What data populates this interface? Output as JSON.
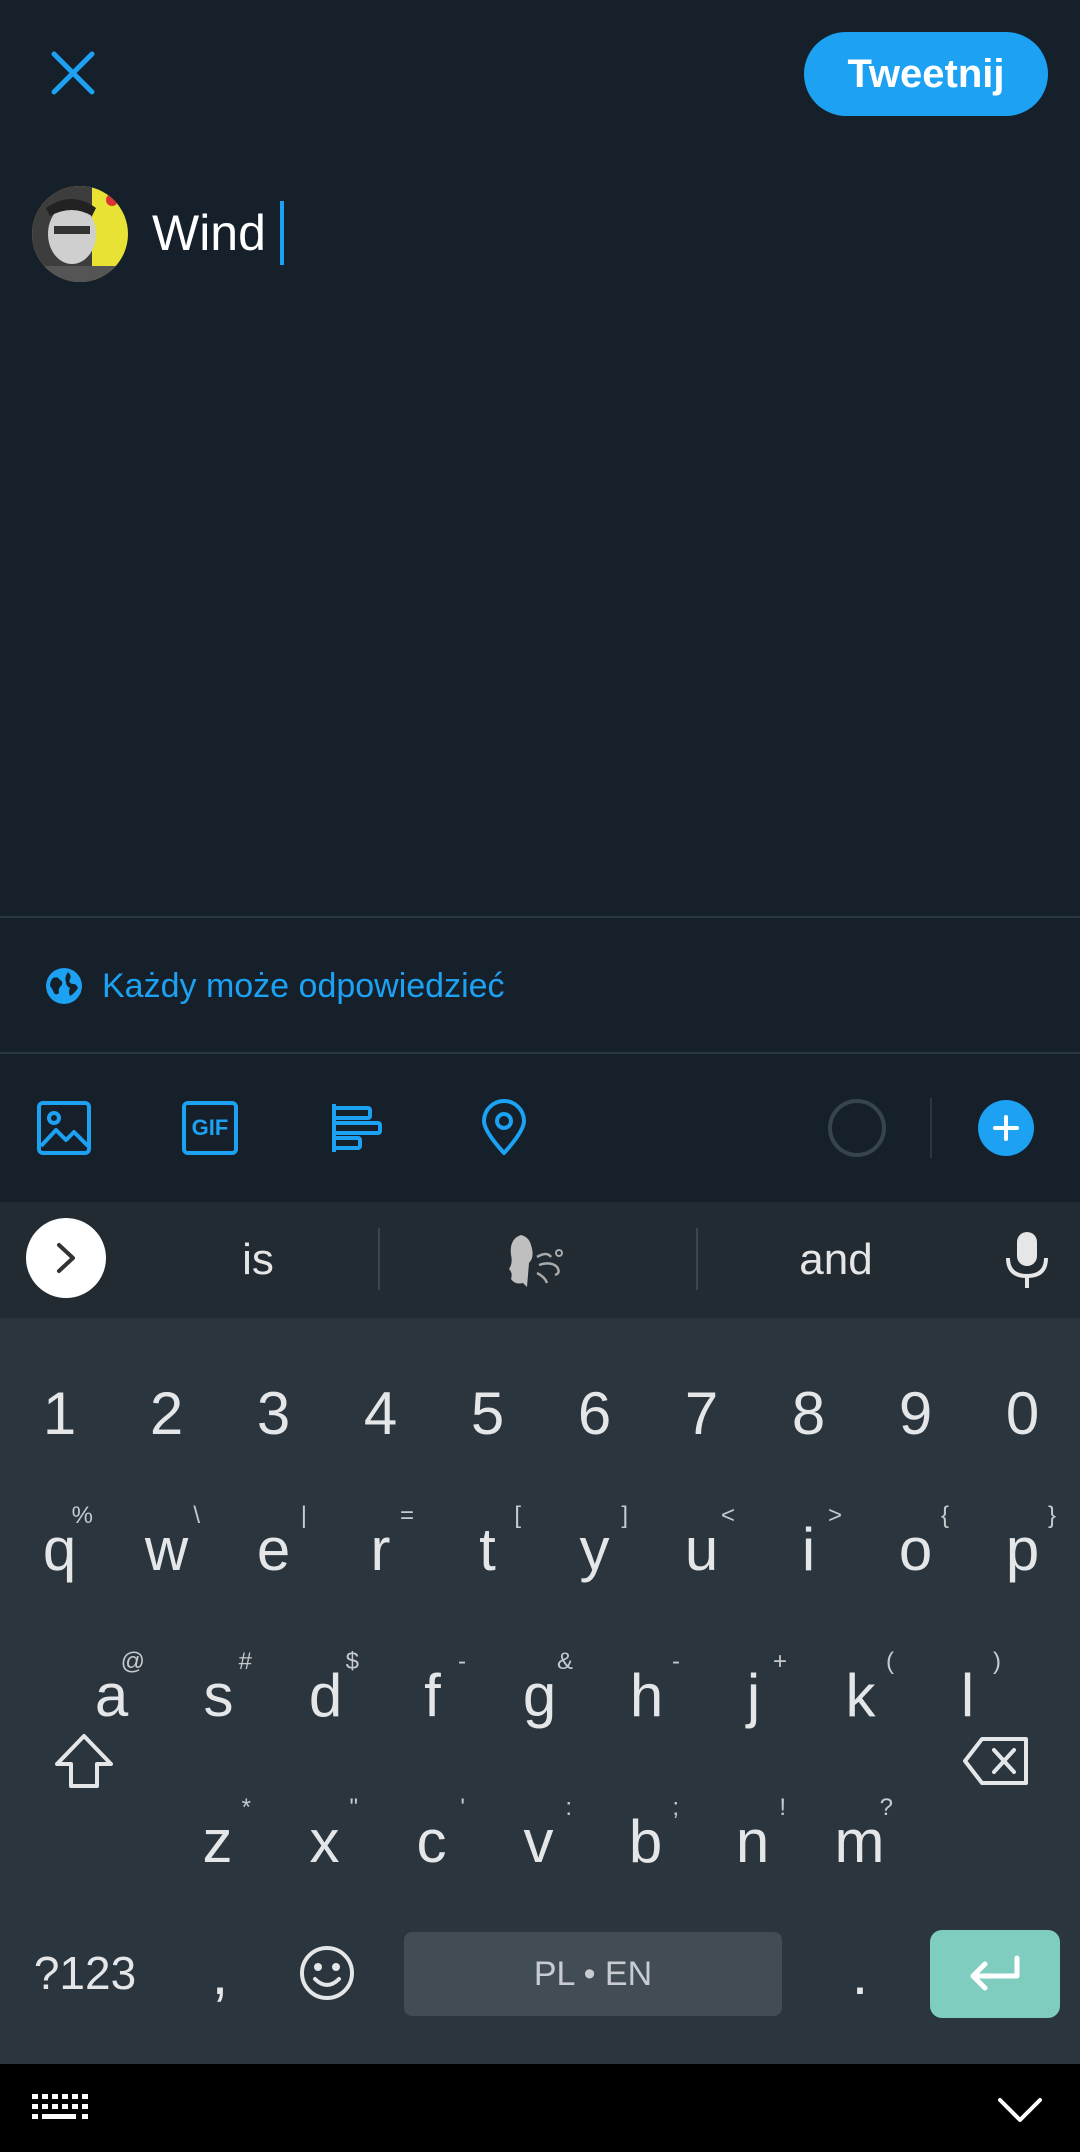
{
  "header": {
    "close_icon": "close-icon",
    "tweet_button_label": "Tweetnij"
  },
  "composer": {
    "text": "Wind",
    "avatar": "user-avatar"
  },
  "reply_settings": {
    "label": "Każdy może odpowiedzieć",
    "icon": "globe-icon"
  },
  "toolbar": {
    "icons": [
      "image-icon",
      "gif-icon",
      "poll-icon",
      "location-icon"
    ],
    "gif_text": "GIF",
    "add_icon": "plus-icon"
  },
  "suggestions": {
    "items": [
      "is",
      "and"
    ],
    "emoji_suggestion": "wind-face-emoji"
  },
  "keyboard": {
    "number_row": [
      "1",
      "2",
      "3",
      "4",
      "5",
      "6",
      "7",
      "8",
      "9",
      "0"
    ],
    "row1": [
      {
        "key": "q",
        "hint": "%"
      },
      {
        "key": "w",
        "hint": "\\"
      },
      {
        "key": "e",
        "hint": "|"
      },
      {
        "key": "r",
        "hint": "="
      },
      {
        "key": "t",
        "hint": "["
      },
      {
        "key": "y",
        "hint": "]"
      },
      {
        "key": "u",
        "hint": "<"
      },
      {
        "key": "i",
        "hint": ">"
      },
      {
        "key": "o",
        "hint": "{"
      },
      {
        "key": "p",
        "hint": "}"
      }
    ],
    "row2": [
      {
        "key": "a",
        "hint": "@"
      },
      {
        "key": "s",
        "hint": "#"
      },
      {
        "key": "d",
        "hint": "$"
      },
      {
        "key": "f",
        "hint": "-"
      },
      {
        "key": "g",
        "hint": "&"
      },
      {
        "key": "h",
        "hint": "-"
      },
      {
        "key": "j",
        "hint": "+"
      },
      {
        "key": "k",
        "hint": "("
      },
      {
        "key": "l",
        "hint": ")"
      }
    ],
    "row3": [
      {
        "key": "z",
        "hint": "*"
      },
      {
        "key": "x",
        "hint": "\""
      },
      {
        "key": "c",
        "hint": "'"
      },
      {
        "key": "v",
        "hint": ":"
      },
      {
        "key": "b",
        "hint": ";"
      },
      {
        "key": "n",
        "hint": "!"
      },
      {
        "key": "m",
        "hint": "?"
      }
    ],
    "symbols_label": "?123",
    "comma": ",",
    "space_label": "PL • EN",
    "period": ".",
    "accent_color": "#7fcdbf"
  },
  "colors": {
    "accent": "#1da1f2",
    "background": "#15202b"
  }
}
